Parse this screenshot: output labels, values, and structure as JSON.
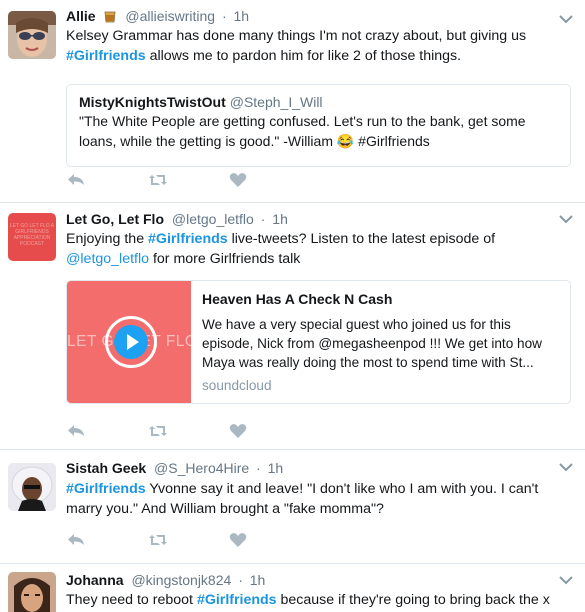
{
  "tweets": [
    {
      "fullname": "Allie",
      "handle": "@allieiswriting",
      "time": "1h",
      "text_pre": "Kelsey Grammar has done many things I'm not crazy about, but giving us ",
      "hashtag": "#Girlfriends",
      "text_post": " allows me to pardon him for like 2 of those things.",
      "quote": {
        "name": "MistyKnightsTwistOut",
        "handle": "@Steph_I_Will",
        "text": "\"The White People are getting confused. Let's run to the bank, get some loans, while the getting is good.\" -William 😂 #Girlfriends"
      }
    },
    {
      "fullname": "Let Go, Let Flo",
      "handle": "@letgo_letflo",
      "time": "1h",
      "avatar_text": "LET GO LET FLO A GIRLFRIENDS APPRECIATION PODCAST",
      "text_a": "Enjoying the ",
      "hashtag": "#Girlfriends",
      "text_b": " live-tweets? Listen to the latest episode of ",
      "mention": "@letgo_letflo",
      "text_c": " for more Girlfriends talk",
      "card": {
        "media_text": "LET GO LET FLO",
        "title": "Heaven Has A Check N Cash",
        "description": "We have a very special guest who joined us for this episode, Nick from @megasheenpod !!! We get into how Maya was really doing the most to spend time with St...",
        "domain": "soundcloud"
      }
    },
    {
      "fullname": "Sistah Geek",
      "handle": "@S_Hero4Hire",
      "time": "1h",
      "hashtag": "#Girlfriends",
      "text_post": " Yvonne say it and leave! \"I don't like who I am with you. I can't marry you.\" And William brought a \"fake momma\"?"
    },
    {
      "fullname": "Johanna",
      "handle": "@kingstonjk824",
      "time": "1h",
      "text_pre": "They need to reboot ",
      "hashtag": "#Girlfriends",
      "text_post": " because if they're going to bring back the x"
    }
  ],
  "separator": "·",
  "icons": {
    "reply": "reply-icon",
    "retweet": "retweet-icon",
    "like": "heart-icon",
    "caret": "chevron-down-icon"
  },
  "colors": {
    "link": "#1b95e0",
    "muted": "#657786",
    "card_media": "#f46d6d"
  }
}
